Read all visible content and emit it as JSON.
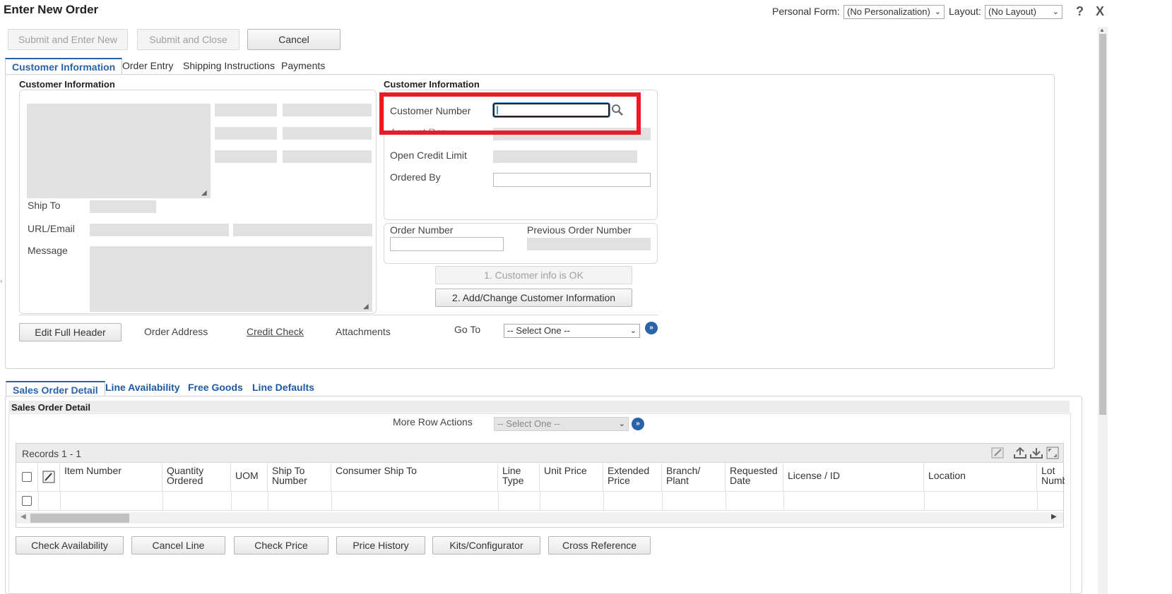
{
  "header": {
    "title": "Enter New Order",
    "personal_form_label": "Personal Form:",
    "personal_form_value": "(No Personalization)",
    "layout_label": "Layout:",
    "layout_value": "(No Layout)",
    "help_icon": "?",
    "close_icon": "X"
  },
  "toolbar": {
    "submit_new": "Submit and Enter New",
    "submit_close": "Submit and Close",
    "cancel": "Cancel"
  },
  "top_tabs": [
    "Customer Information",
    "Order Entry",
    "Shipping Instructions",
    "Payments"
  ],
  "left_section": {
    "heading": "Customer Information",
    "ship_to_label": "Ship To",
    "url_email_label": "URL/Email",
    "message_label": "Message"
  },
  "right_section": {
    "heading": "Customer Information",
    "customer_number_label": "Customer Number",
    "account_rep_label": "Account Rep",
    "open_credit_limit_label": "Open Credit Limit",
    "ordered_by_label": "Ordered By",
    "order_number_label": "Order Number",
    "previous_order_number_label": "Previous Order Number",
    "customer_info_ok": "1. Customer info is OK",
    "add_change_customer": "2. Add/Change Customer Information"
  },
  "header_actions": {
    "edit_full_header": "Edit Full Header",
    "order_address": "Order Address",
    "credit_check": "Credit Check",
    "attachments": "Attachments",
    "go_to_label": "Go To",
    "go_to_value": "-- Select One --"
  },
  "bottom_tabs": [
    "Sales Order Detail",
    "Line Availability",
    "Free Goods",
    "Line Defaults"
  ],
  "detail": {
    "heading": "Sales Order Detail",
    "more_row_actions_label": "More Row Actions",
    "more_row_actions_value": "-- Select One --",
    "records": "Records 1 - 1",
    "columns": [
      "Item Number",
      "Quantity Ordered",
      "UOM",
      "Ship To Number",
      "Consumer Ship To",
      "Line Type",
      "Unit Price",
      "Extended Price",
      "Branch/ Plant",
      "Requested Date",
      "License / ID",
      "Location",
      "Lot Numb"
    ]
  },
  "bottom_buttons": [
    "Check Availability",
    "Cancel Line",
    "Check Price",
    "Price History",
    "Kits/Configurator",
    "Cross Reference"
  ],
  "colors": {
    "accent": "#2a63a8",
    "highlight": "#e81c24",
    "readonly_field": "#e1e1e1"
  }
}
